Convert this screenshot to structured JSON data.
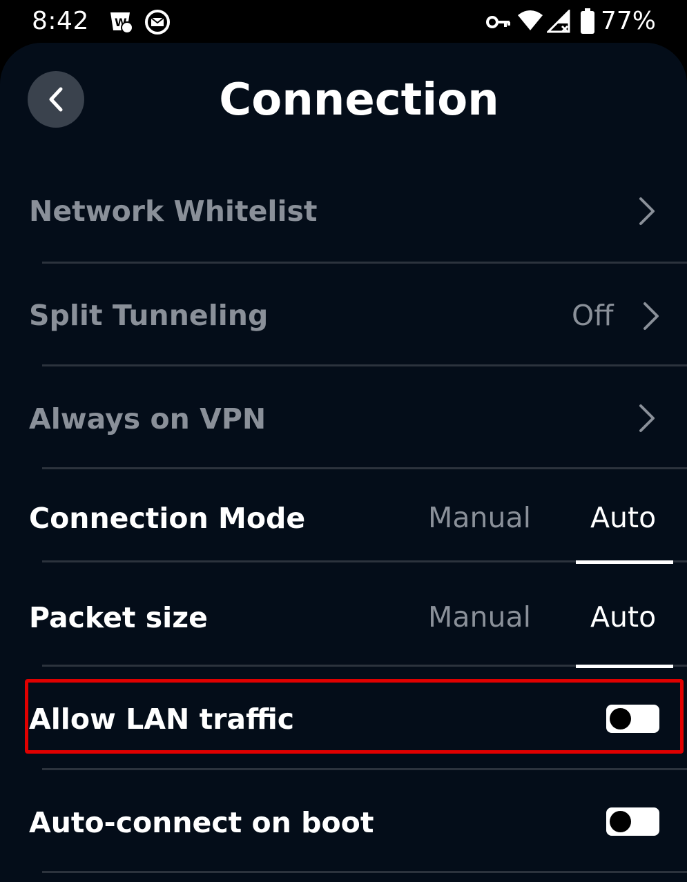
{
  "status_bar": {
    "time": "8:42",
    "battery_percent": "77%",
    "icons": [
      "notification-badge-icon",
      "mail-icon",
      "vpn-key-icon",
      "wifi-icon",
      "signal-icon",
      "battery-icon"
    ]
  },
  "header": {
    "title": "Connection",
    "back_icon": "chevron-left-icon"
  },
  "rows": {
    "network_whitelist": {
      "label": "Network Whitelist"
    },
    "split_tunneling": {
      "label": "Split Tunneling",
      "value": "Off"
    },
    "always_on_vpn": {
      "label": "Always on VPN"
    },
    "connection_mode": {
      "label": "Connection Mode",
      "options": [
        "Manual",
        "Auto"
      ],
      "selected": "Auto"
    },
    "packet_size": {
      "label": "Packet size",
      "options": [
        "Manual",
        "Auto"
      ],
      "selected": "Auto"
    },
    "allow_lan_traffic": {
      "label": "Allow LAN traffic",
      "enabled": false
    },
    "auto_connect_on_boot": {
      "label": "Auto-connect on boot",
      "enabled": false
    }
  },
  "colors": {
    "background": "#040d19",
    "dim_text": "#8a9099",
    "divider": "#2c333d",
    "highlight": "#e00000"
  }
}
